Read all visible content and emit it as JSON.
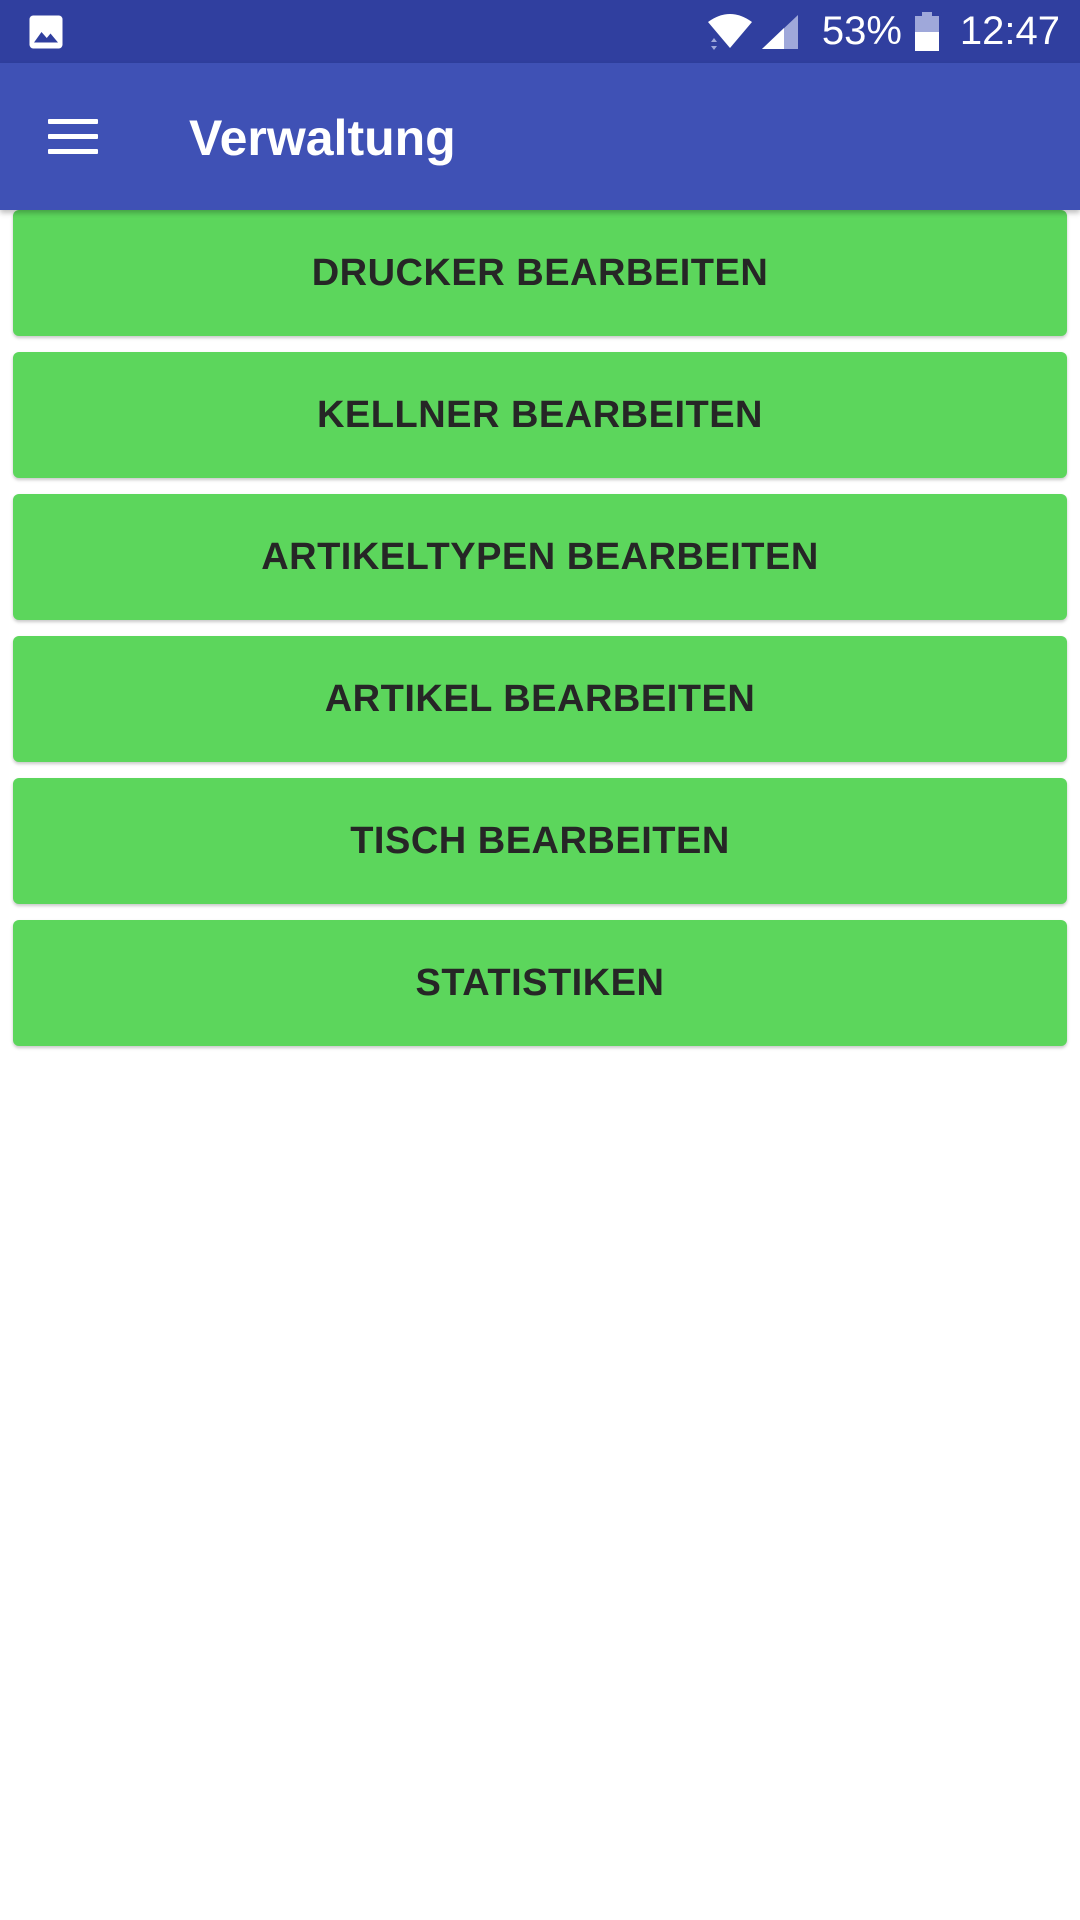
{
  "status_bar": {
    "left_icon": "image-icon",
    "battery_percent": "53%",
    "time": "12:47",
    "icons": [
      "wifi-icon",
      "signal-icon",
      "battery-icon"
    ]
  },
  "app_bar": {
    "menu_icon": "hamburger-menu-icon",
    "title": "Verwaltung"
  },
  "buttons": [
    {
      "label": "DRUCKER BEARBEITEN"
    },
    {
      "label": "KELLNER BEARBEITEN"
    },
    {
      "label": "ARTIKELTYPEN BEARBEITEN"
    },
    {
      "label": "ARTIKEL BEARBEITEN"
    },
    {
      "label": "TISCH BEARBEITEN"
    },
    {
      "label": "STATISTIKEN"
    }
  ],
  "colors": {
    "status_bar": "#303f9f",
    "app_bar": "#3f51b5",
    "button_bg": "#5cd65c",
    "button_text": "#262626",
    "background": "#ffffff"
  }
}
